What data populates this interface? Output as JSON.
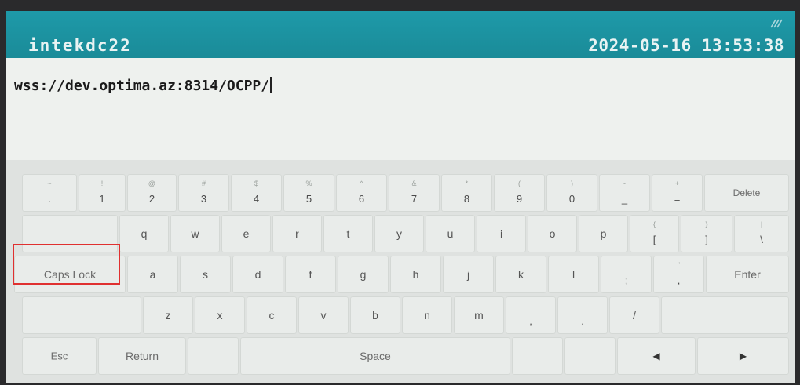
{
  "header": {
    "device_name": "intekdc22",
    "datetime": "2024-05-16 13:53:38",
    "signal_icon": "signal-icon"
  },
  "input": {
    "value": "wss://dev.optima.az:8314/OCPP/"
  },
  "keyboard": {
    "row1": [
      {
        "main": ".",
        "shift": "~"
      },
      {
        "main": "1",
        "shift": "!"
      },
      {
        "main": "2",
        "shift": "@"
      },
      {
        "main": "3",
        "shift": "#"
      },
      {
        "main": "4",
        "shift": "$"
      },
      {
        "main": "5",
        "shift": "%"
      },
      {
        "main": "6",
        "shift": "^"
      },
      {
        "main": "7",
        "shift": "&"
      },
      {
        "main": "8",
        "shift": "*"
      },
      {
        "main": "9",
        "shift": "("
      },
      {
        "main": "0",
        "shift": ")"
      },
      {
        "main": "_",
        "shift": "-"
      },
      {
        "main": "=",
        "shift": "+"
      }
    ],
    "delete": "Delete",
    "row2": [
      "q",
      "w",
      "e",
      "r",
      "t",
      "y",
      "u",
      "i",
      "o",
      "p"
    ],
    "row2_sym": [
      {
        "main": "[",
        "shift": "{"
      },
      {
        "main": "]",
        "shift": "}"
      },
      {
        "main": "\\",
        "shift": "|"
      }
    ],
    "caps_lock": "Caps Lock",
    "row3": [
      "a",
      "s",
      "d",
      "f",
      "g",
      "h",
      "j",
      "k",
      "l"
    ],
    "row3_sym": [
      {
        "main": ";",
        "shift": ":"
      },
      {
        "main": ",",
        "shift": "\""
      }
    ],
    "enter": "Enter",
    "row4": [
      "z",
      "x",
      "c",
      "v",
      "b",
      "n",
      "m",
      ",",
      ".",
      "/"
    ],
    "esc": "Esc",
    "return": "Return",
    "space": "Space",
    "left_arrow": "◀",
    "right_arrow": "▶"
  },
  "annotation": {
    "highlight_color": "#e03030"
  }
}
